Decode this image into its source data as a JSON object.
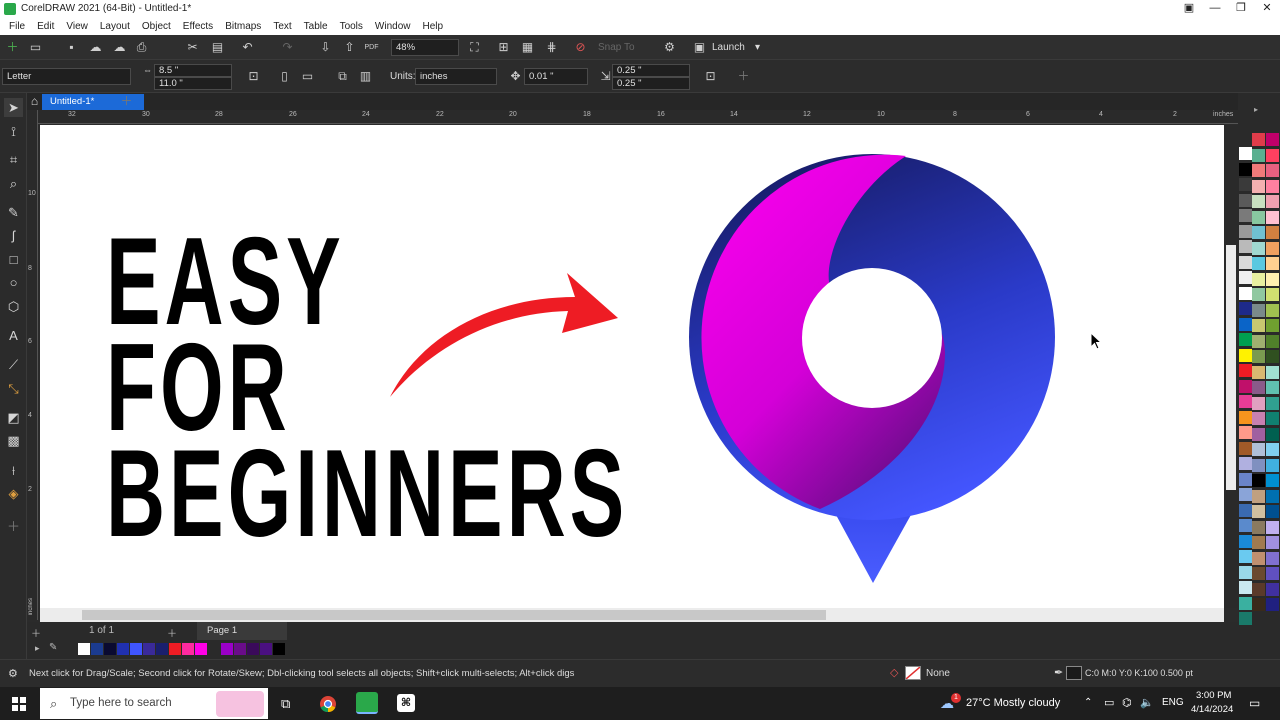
{
  "window": {
    "title": "CorelDRAW 2021 (64-Bit) - Untitled-1*"
  },
  "menu": [
    "File",
    "Edit",
    "View",
    "Layout",
    "Object",
    "Effects",
    "Bitmaps",
    "Text",
    "Table",
    "Tools",
    "Window",
    "Help"
  ],
  "standard_toolbar": {
    "zoom": "48%",
    "snap_to": "Snap To",
    "launch": "Launch"
  },
  "property_bar": {
    "page_size": "Letter",
    "width": "8.5 \"",
    "height": "11.0 \"",
    "units_label": "Units:",
    "units": "inches",
    "nudge": "0.01 \"",
    "dup_x": "0.25 \"",
    "dup_y": "0.25 \""
  },
  "doc_tab": "Untitled-1*",
  "ruler": {
    "top_ticks": [
      "32",
      "30",
      "28",
      "26",
      "24",
      "22",
      "20",
      "18",
      "16",
      "14",
      "12",
      "10",
      "8",
      "6",
      "4",
      "2"
    ],
    "units": "inches",
    "left_units": "inches",
    "left_ticks": [
      "10",
      "8",
      "6",
      "4",
      "2"
    ]
  },
  "artwork": {
    "headline_lines": [
      "EASY",
      "FOR",
      "BEGINNERS"
    ],
    "colors": {
      "magenta": "#ff00e6",
      "navy": "#1a1f6e",
      "blue": "#3f55ff",
      "arrow_red": "#ee1c24"
    }
  },
  "page_nav": {
    "counter": "1 of 1",
    "page_tab": "Page 1"
  },
  "status": {
    "hint": "Next click for Drag/Scale; Second click for Rotate/Skew; Dbl-clicking tool selects all objects; Shift+click multi-selects; Alt+click digs",
    "fill": "None",
    "outline": "C:0 M:0 Y:0 K:100  0.500 pt"
  },
  "taskbar": {
    "search_placeholder": "Type here to search",
    "weather": "27°C  Mostly cloudy",
    "weather_badge": "1",
    "lang": "ENG",
    "time": "3:00 PM",
    "date": "4/14/2024"
  }
}
